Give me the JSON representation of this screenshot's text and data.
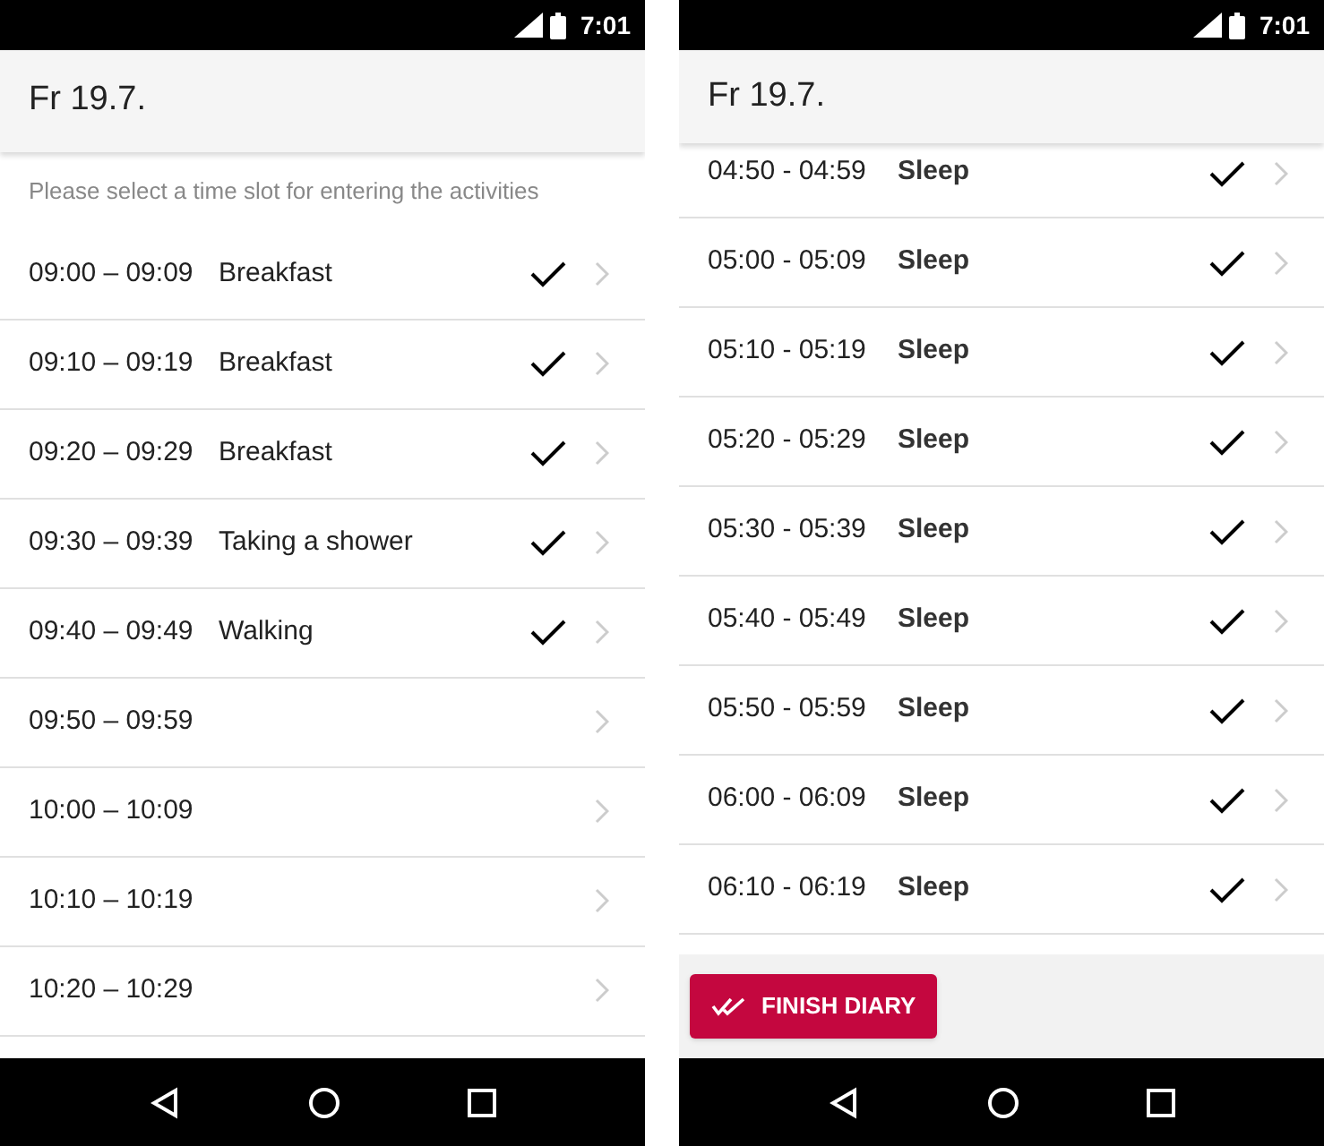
{
  "screens": [
    {
      "status_time": "7:01",
      "title": "Fr 19.7.",
      "hint": "Please select a time slot for entering the activities",
      "scrolled": false,
      "slots": [
        {
          "time": "09:00 – 09:09",
          "activity": "Breakfast",
          "done": true
        },
        {
          "time": "09:10 – 09:19",
          "activity": "Breakfast",
          "done": true
        },
        {
          "time": "09:20 – 09:29",
          "activity": "Breakfast",
          "done": true
        },
        {
          "time": "09:30 – 09:39",
          "activity": "Taking a shower",
          "done": true
        },
        {
          "time": "09:40 – 09:49",
          "activity": "Walking",
          "done": true
        },
        {
          "time": "09:50 – 09:59",
          "done": false
        },
        {
          "time": "10:00 – 10:09",
          "done": false
        },
        {
          "time": "10:10 – 10:19",
          "done": false
        },
        {
          "time": "10:20 – 10:29",
          "done": false
        }
      ]
    },
    {
      "status_time": "7:01",
      "title": "Fr 19.7.",
      "scrolled": true,
      "slots": [
        {
          "time": "04:50 - 04:59",
          "activity": "Sleep",
          "done": true
        },
        {
          "time": "05:00 - 05:09",
          "activity": "Sleep",
          "done": true
        },
        {
          "time": "05:10 - 05:19",
          "activity": "Sleep",
          "done": true
        },
        {
          "time": "05:20 - 05:29",
          "activity": "Sleep",
          "done": true
        },
        {
          "time": "05:30 - 05:39",
          "activity": "Sleep",
          "done": true
        },
        {
          "time": "05:40 - 05:49",
          "activity": "Sleep",
          "done": true
        },
        {
          "time": "05:50 - 05:59",
          "activity": "Sleep",
          "done": true
        },
        {
          "time": "06:00 - 06:09",
          "activity": "Sleep",
          "done": true
        },
        {
          "time": "06:10 - 06:19",
          "activity": "Sleep",
          "done": true
        }
      ],
      "finish_button": "FINISH DIARY"
    }
  ]
}
